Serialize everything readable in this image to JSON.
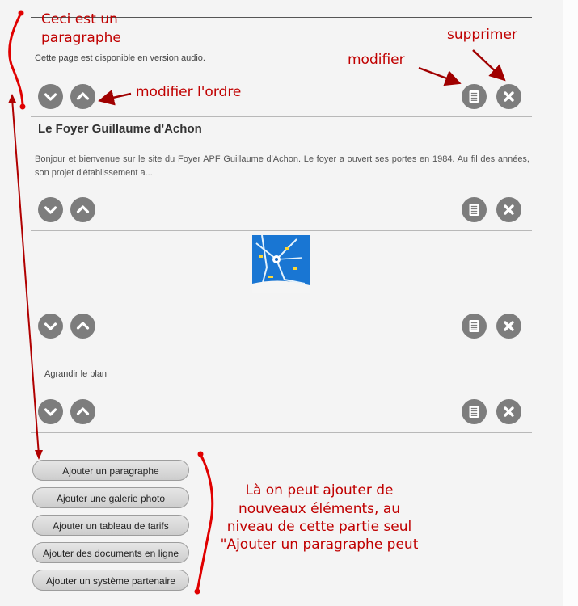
{
  "paragraphs": [
    {
      "text": "Cette page est disponible en version audio."
    },
    {
      "title": "Le Foyer Guillaume d'Achon",
      "text": "Bonjour et bienvenue sur le site du Foyer APF Guillaume d'Achon. Le foyer a ouvert ses portes en 1984. Au fil des années, son projet d'établissement a..."
    },
    {
      "image": "plan-thumbnail"
    },
    {
      "text": "Agrandir le plan"
    }
  ],
  "add_buttons": [
    "Ajouter un paragraphe",
    "Ajouter une galerie photo",
    "Ajouter un tableau de tarifs",
    "Ajouter des documents en ligne",
    "Ajouter un système partenaire"
  ],
  "annotations": {
    "paragraph_line1": "Ceci est un",
    "paragraph_line2": "paragraphe",
    "reorder": "modifier l'ordre",
    "edit": "modifier",
    "delete": "supprimer",
    "add_line1": "Là on peut ajouter de",
    "add_line2": "nouveaux éléments, au",
    "add_line3": "niveau de cette partie seul",
    "add_line4": "\"Ajouter un paragraphe peut"
  },
  "icons": {
    "move_down": "chevron-down-icon",
    "move_up": "chevron-up-icon",
    "edit": "list-edit-icon",
    "delete": "close-icon"
  },
  "colors": {
    "annotation": "#cc0000",
    "icon_button": "#7d7d7d"
  }
}
